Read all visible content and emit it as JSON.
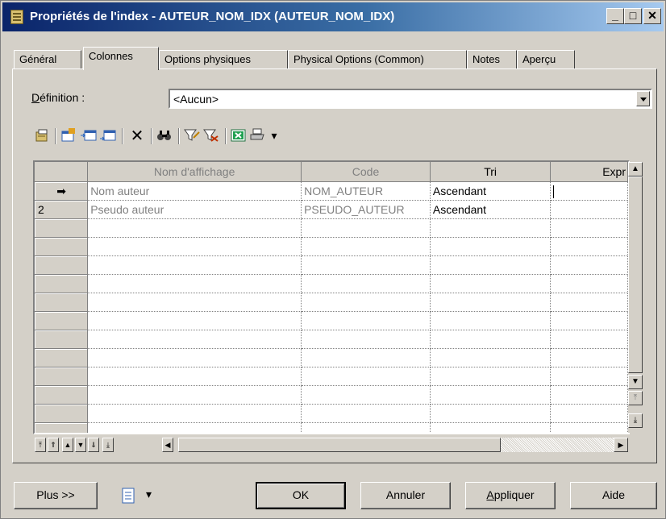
{
  "window": {
    "title": "Propriétés de l'index - AUTEUR_NOM_IDX (AUTEUR_NOM_IDX)",
    "min_glyph": "_",
    "max_glyph": "□",
    "close_glyph": "✕"
  },
  "tabs": [
    {
      "label": "Général"
    },
    {
      "label": "Colonnes"
    },
    {
      "label": "Options physiques"
    },
    {
      "label": "Physical Options (Common)"
    },
    {
      "label": "Notes"
    },
    {
      "label": "Aperçu"
    }
  ],
  "active_tab": "Colonnes",
  "definition": {
    "label_first": "D",
    "label_rest": "éfinition :",
    "value": "<Aucun>"
  },
  "toolbar": {
    "icons": [
      "properties-icon",
      "add-columns-icon",
      "insert-row-icon",
      "add-row-icon",
      "delete-icon",
      "find-icon",
      "filter-icon",
      "clear-filter-icon",
      "excel-export-icon",
      "print-icon",
      "more-dropdown-icon"
    ],
    "glyphs": {
      "delete": "✕",
      "find": "🔍",
      "dropdown": "▾"
    }
  },
  "grid": {
    "columns": [
      "Nom d'affichage",
      "Code",
      "Tri",
      "Expr"
    ],
    "rows": [
      {
        "marker": "➡",
        "name": "Nom auteur",
        "code": "NOM_AUTEUR",
        "sort": "Ascendant",
        "expr": ""
      },
      {
        "marker": "2",
        "name": "Pseudo auteur",
        "code": "PSEUDO_AUTEUR",
        "sort": "Ascendant",
        "expr": ""
      }
    ]
  },
  "nav_buttons": {
    "first": "⤒",
    "prev_page": "⇑",
    "up": "▲",
    "down": "▼",
    "next_page": "⇓",
    "last": "⤓",
    "left": "◀",
    "right": "▶"
  },
  "buttons": {
    "more": "Plus >>",
    "ok": "OK",
    "cancel": "Annuler",
    "apply_first": "A",
    "apply_rest": "ppliquer",
    "help": "Aide"
  }
}
